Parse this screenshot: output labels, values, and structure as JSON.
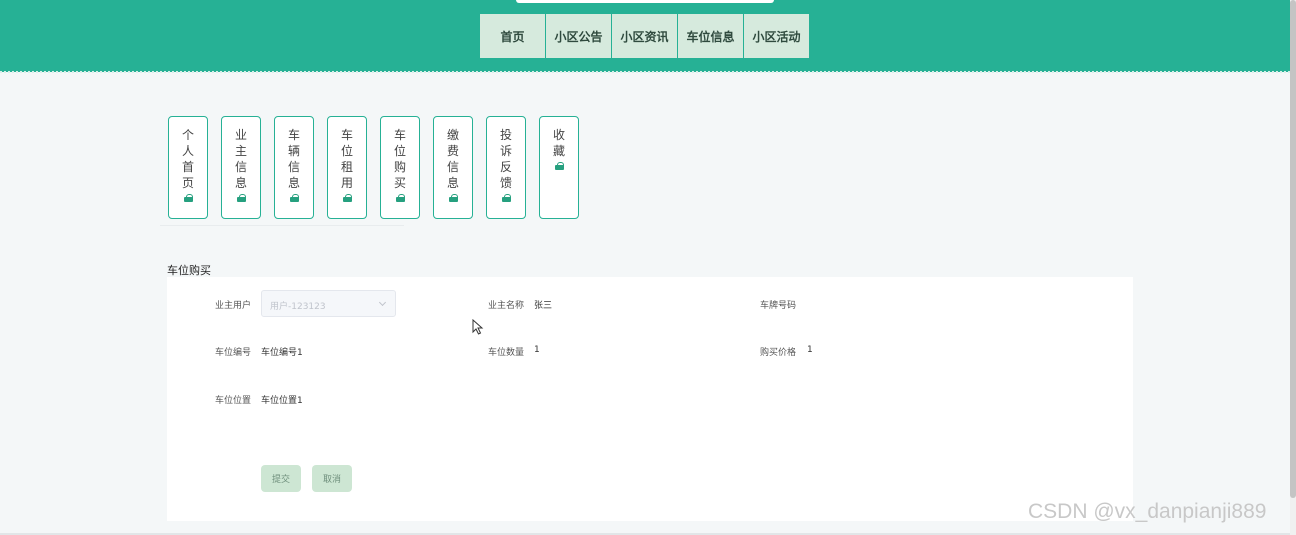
{
  "nav": {
    "items": [
      {
        "label": "首页"
      },
      {
        "label": "小区公告"
      },
      {
        "label": "小区资讯"
      },
      {
        "label": "车位信息"
      },
      {
        "label": "小区活动"
      }
    ]
  },
  "tabs": [
    {
      "label": "个人首页",
      "icon": "home-icon"
    },
    {
      "label": "业主信息",
      "icon": "home-icon"
    },
    {
      "label": "车辆信息",
      "icon": "home-icon"
    },
    {
      "label": "车位租用",
      "icon": "home-icon"
    },
    {
      "label": "车位购买",
      "icon": "home-icon"
    },
    {
      "label": "缴费信息",
      "icon": "home-icon"
    },
    {
      "label": "投诉反馈",
      "icon": "home-icon"
    },
    {
      "label": "收藏",
      "icon": "home-icon"
    }
  ],
  "section": {
    "title": "车位购买"
  },
  "form": {
    "owner_user_label": "业主用户",
    "owner_user_placeholder": "用户-123123",
    "owner_name_label": "业主名称",
    "owner_name_value": "张三",
    "plate_label": "车牌号码",
    "plate_value": "",
    "space_no_label": "车位编号",
    "space_no_value": "车位编号1",
    "space_count_label": "车位数量",
    "space_count_value": "1",
    "price_label": "购买价格",
    "price_value": "1",
    "location_label": "车位位置",
    "location_value": "车位位置1"
  },
  "actions": {
    "submit_label": "提交",
    "cancel_label": "取消"
  },
  "watermark": "CSDN @vx_danpianji889",
  "colors": {
    "primary": "#26b195",
    "nav_bg": "#d6eadd",
    "button_bg": "#cde6d3"
  }
}
